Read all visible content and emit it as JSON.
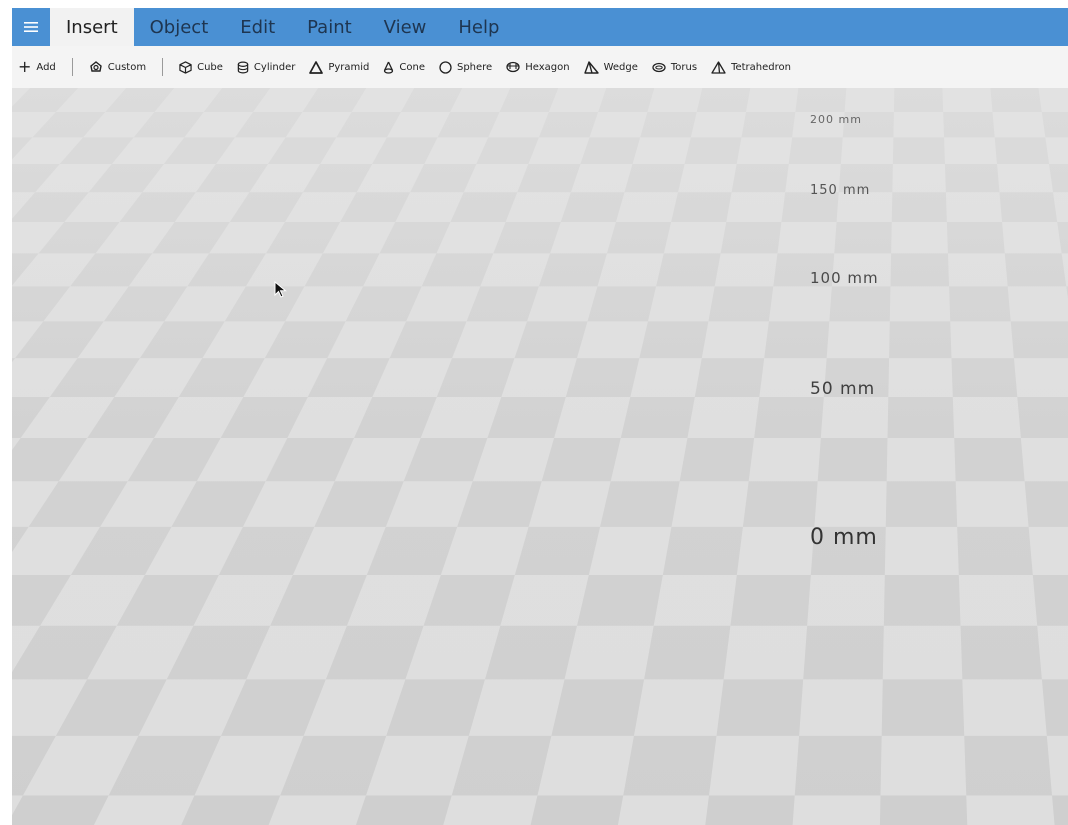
{
  "menu": {
    "hamburger_icon": "hamburger-menu-icon",
    "tabs": [
      {
        "label": "Insert",
        "active": true
      },
      {
        "label": "Object",
        "active": false
      },
      {
        "label": "Edit",
        "active": false
      },
      {
        "label": "Paint",
        "active": false
      },
      {
        "label": "View",
        "active": false
      },
      {
        "label": "Help",
        "active": false
      }
    ]
  },
  "toolbar": {
    "add_label": "Add",
    "custom_label": "Custom",
    "shapes": [
      {
        "label": "Cube",
        "icon": "cube-icon"
      },
      {
        "label": "Cylinder",
        "icon": "cylinder-icon"
      },
      {
        "label": "Pyramid",
        "icon": "pyramid-icon"
      },
      {
        "label": "Cone",
        "icon": "cone-icon"
      },
      {
        "label": "Sphere",
        "icon": "sphere-icon"
      },
      {
        "label": "Hexagon",
        "icon": "hexagon-icon"
      },
      {
        "label": "Wedge",
        "icon": "wedge-icon"
      },
      {
        "label": "Torus",
        "icon": "torus-icon"
      },
      {
        "label": "Tetrahedron",
        "icon": "tetrahedron-icon"
      }
    ]
  },
  "viewport": {
    "ruler": [
      {
        "label": "200 mm"
      },
      {
        "label": "150 mm"
      },
      {
        "label": "100 mm"
      },
      {
        "label": "50 mm"
      },
      {
        "label": "0 mm"
      }
    ]
  },
  "colors": {
    "menu_bar": "#4a90d3",
    "toolbar": "#f4f4f4",
    "grid_light": "#dedede",
    "grid_dark": "#cfcfcf"
  }
}
